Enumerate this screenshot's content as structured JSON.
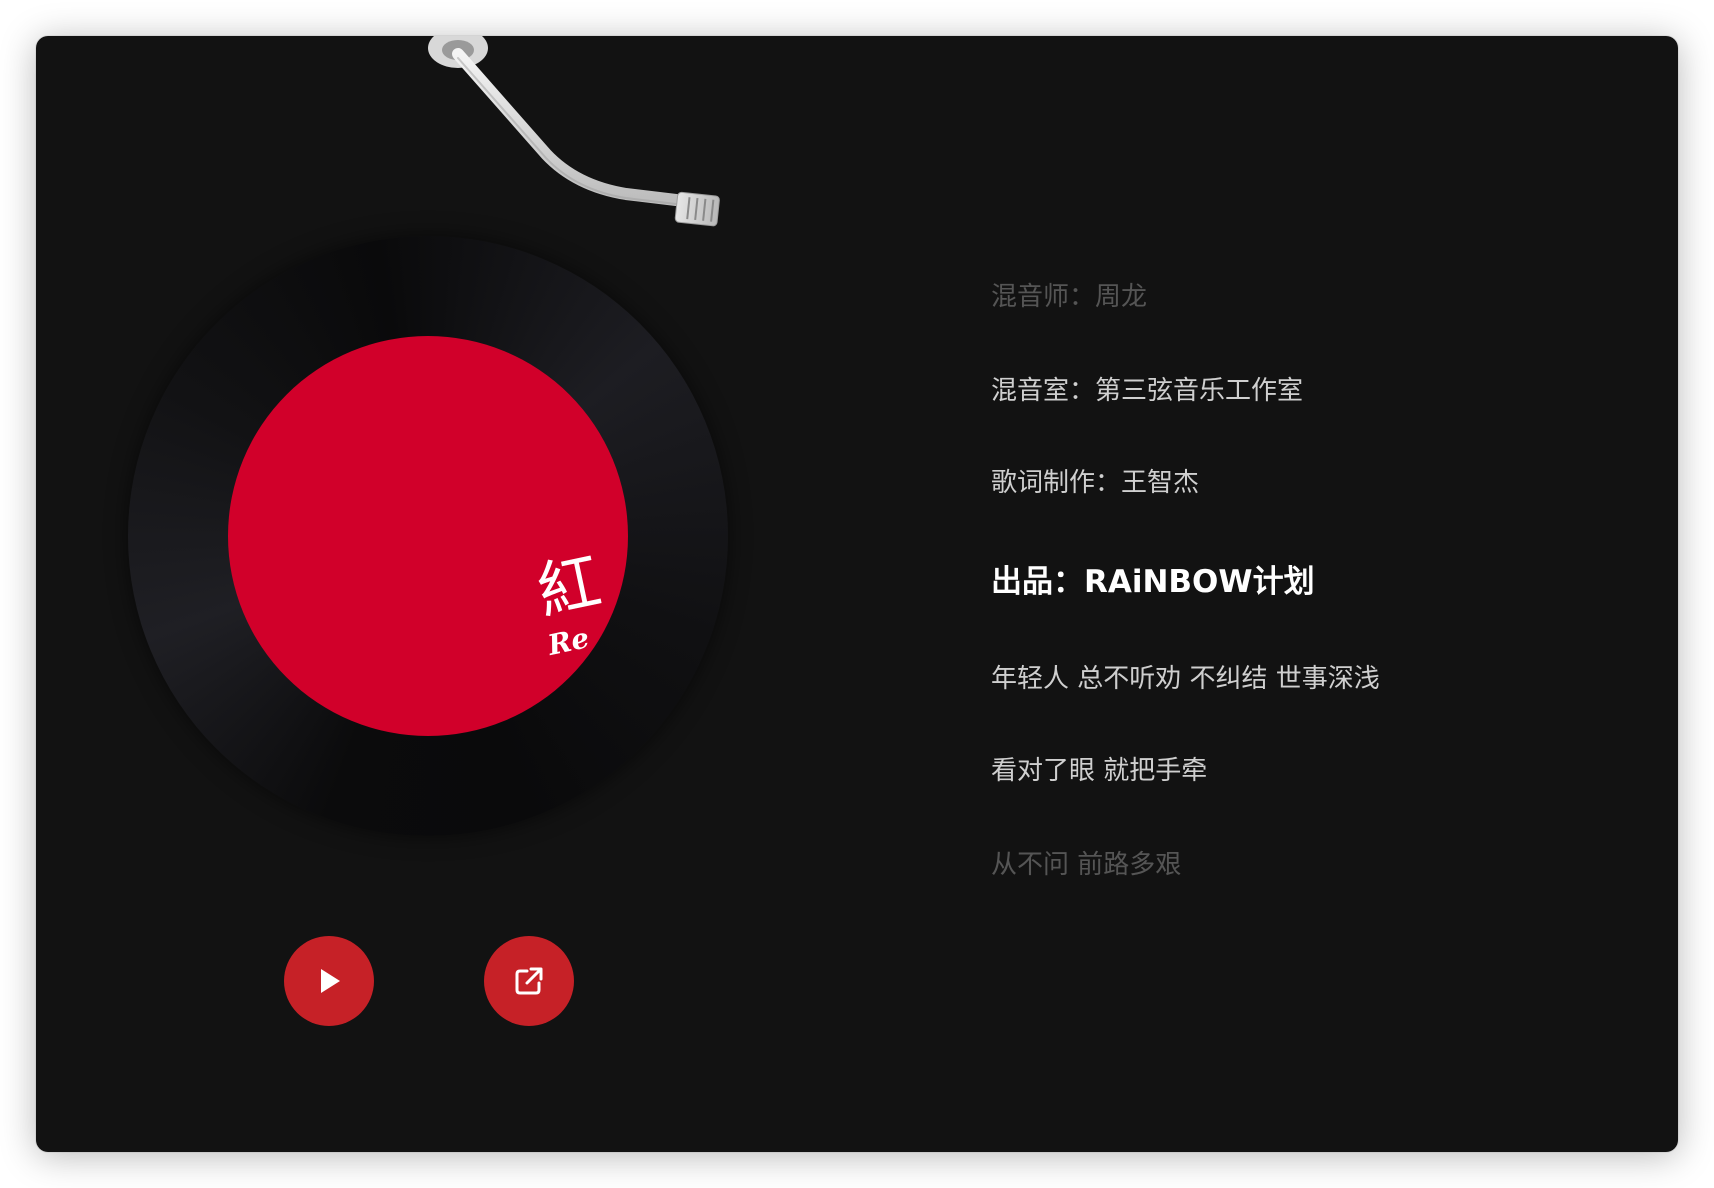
{
  "player": {
    "album_label_glyph": "紅",
    "album_label_sub": "Re",
    "accent_color": "#c62127",
    "record_label_color": "#d1002a",
    "controls": {
      "play_icon": "play-icon",
      "share_icon": "external-link-icon"
    }
  },
  "lyrics": {
    "lines": [
      {
        "text": "混音师：周龙",
        "state": "dim"
      },
      {
        "text": "混音室：第三弦音乐工作室",
        "state": "mid"
      },
      {
        "text": "歌词制作：王智杰",
        "state": "mid"
      },
      {
        "text": "出品：RAiNBOW计划",
        "state": "active"
      },
      {
        "text": "年轻人 总不听劝 不纠结 世事深浅",
        "state": "mid"
      },
      {
        "text": "看对了眼 就把手牵",
        "state": "mid"
      },
      {
        "text": "从不问 前路多艰",
        "state": "dim"
      }
    ]
  }
}
